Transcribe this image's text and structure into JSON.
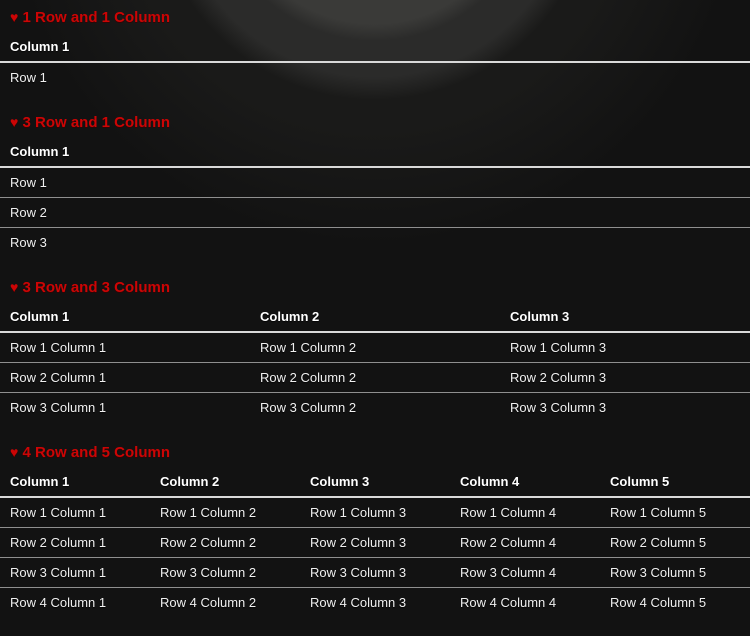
{
  "theme": {
    "page_bg": "#121212",
    "accent": "#cc0505",
    "header_text": "#ffffff",
    "cell_text": "#f0f0f0",
    "header_border": "#d9d9d9",
    "row_border": "#8f8f8f",
    "glow_inner": "#3a3a38",
    "glow_ring": "#2b2b2a",
    "glow_fade": "#1a1a19"
  },
  "heart_icon_glyph": "♥",
  "sections": [
    {
      "title": "1 Row and 1 Column",
      "columns": [
        "Column 1"
      ],
      "rows": [
        [
          "Row 1"
        ]
      ]
    },
    {
      "title": "3 Row and 1 Column",
      "columns": [
        "Column 1"
      ],
      "rows": [
        [
          "Row 1"
        ],
        [
          "Row 2"
        ],
        [
          "Row 3"
        ]
      ]
    },
    {
      "title": "3 Row and 3 Column",
      "columns": [
        "Column 1",
        "Column 2",
        "Column 3"
      ],
      "rows": [
        [
          "Row 1 Column 1",
          "Row 1 Column 2",
          "Row 1 Column 3"
        ],
        [
          "Row 2 Column 1",
          "Row 2 Column 2",
          "Row 2 Column 3"
        ],
        [
          "Row 3 Column 1",
          "Row 3 Column 2",
          "Row 3 Column 3"
        ]
      ]
    },
    {
      "title": "4 Row and 5 Column",
      "columns": [
        "Column 1",
        "Column 2",
        "Column 3",
        "Column 4",
        "Column 5"
      ],
      "rows": [
        [
          "Row 1 Column 1",
          "Row 1 Column 2",
          "Row 1 Column 3",
          "Row 1 Column 4",
          "Row 1 Column 5"
        ],
        [
          "Row 2 Column 1",
          "Row 2 Column 2",
          "Row 2 Column 3",
          "Row 2 Column 4",
          "Row 2 Column 5"
        ],
        [
          "Row 3 Column 1",
          "Row 3 Column 2",
          "Row 3 Column 3",
          "Row 3 Column 4",
          "Row 3 Column 5"
        ],
        [
          "Row 4 Column 1",
          "Row 4 Column 2",
          "Row 4 Column 3",
          "Row 4 Column 4",
          "Row 4 Column 5"
        ]
      ]
    }
  ]
}
